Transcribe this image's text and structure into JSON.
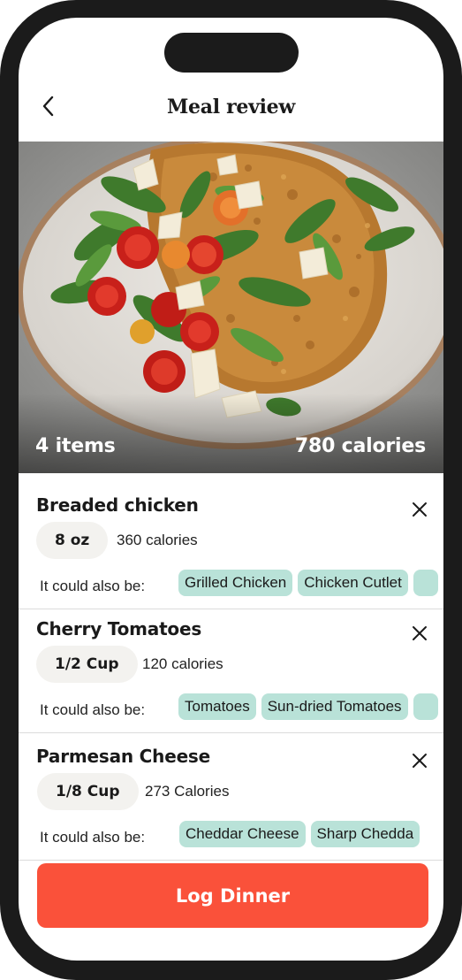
{
  "header": {
    "title": "Meal review",
    "back_icon": "chevron-left-icon"
  },
  "hero": {
    "items_label": "4 items",
    "calories_label": "780 calories"
  },
  "alt_label": "It could also be:",
  "foods": [
    {
      "name": "Breaded chicken",
      "portion": "8 oz",
      "calories": "360 calories",
      "alternatives": [
        "Grilled Chicken",
        "Chicken Cutlet",
        ""
      ]
    },
    {
      "name": "Cherry Tomatoes",
      "portion": "1/2 Cup",
      "calories": "120 calories",
      "alternatives": [
        "Tomatoes",
        "Sun-dried Tomatoes",
        ""
      ]
    },
    {
      "name": "Parmesan Cheese",
      "portion": "1/8 Cup",
      "calories": "273 Calories",
      "alternatives": [
        "Cheddar Cheese",
        "Sharp Chedda"
      ]
    }
  ],
  "cta": {
    "label": "Log Dinner"
  },
  "colors": {
    "accent": "#fa513a",
    "chip": "#b9e2d8",
    "pill": "#f3f2ef",
    "frame": "#1b1b1b"
  }
}
